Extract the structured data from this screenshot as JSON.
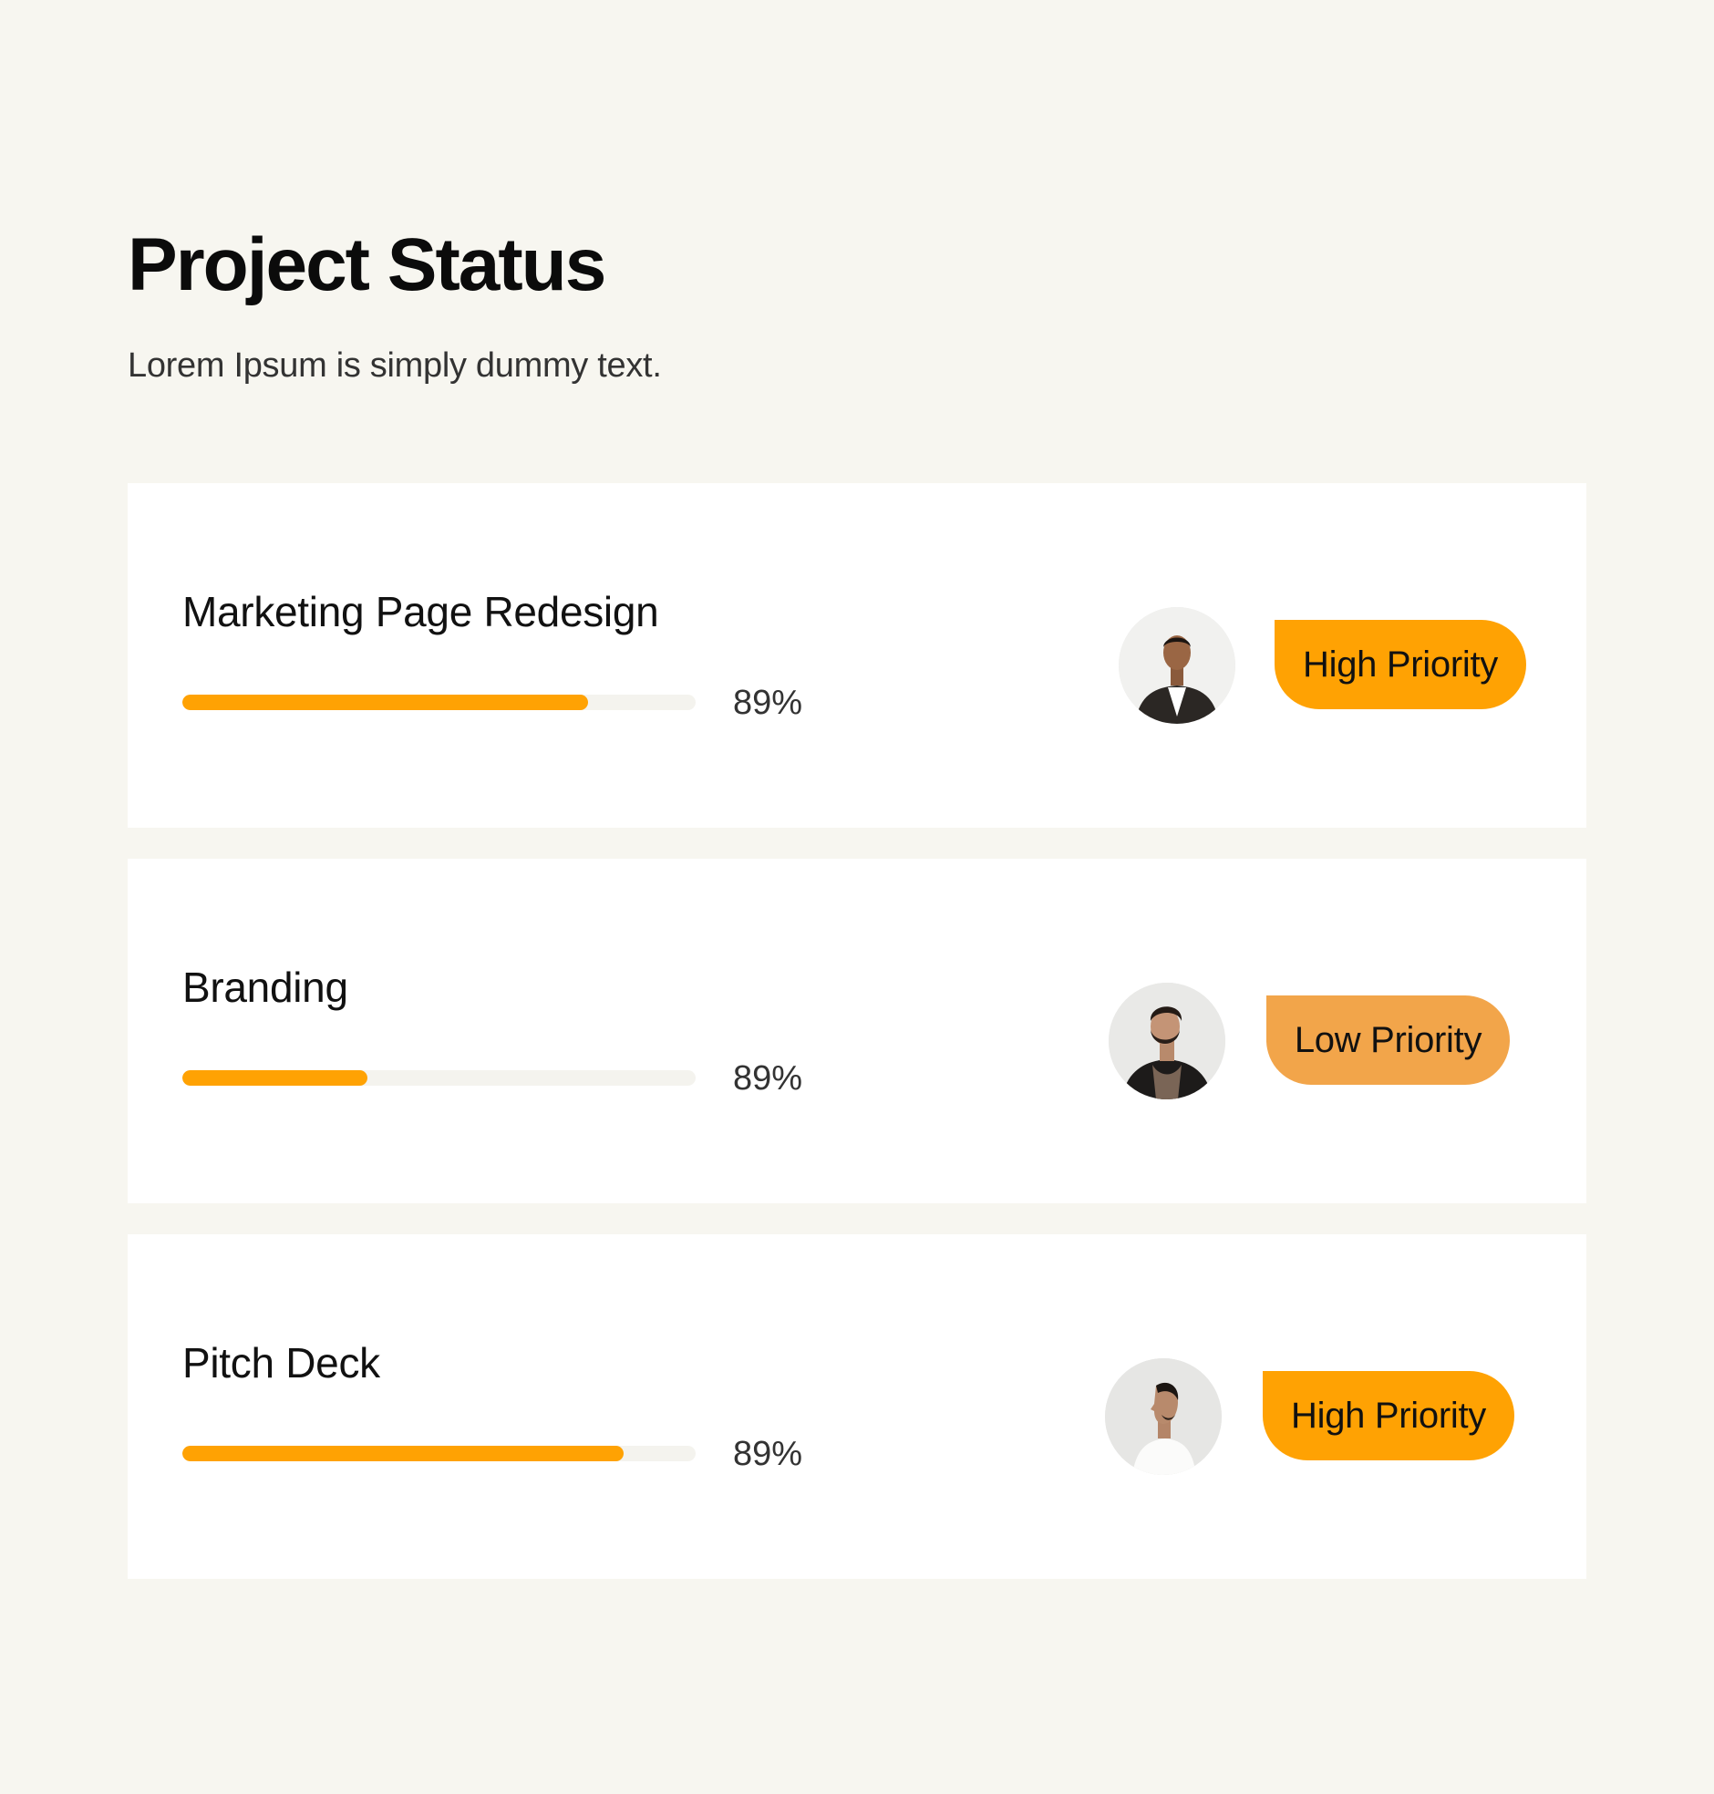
{
  "header": {
    "title": "Project Status",
    "subtitle": "Lorem Ipsum is simply dummy text."
  },
  "projects": [
    {
      "name": "Marketing Page Redesign",
      "progress_fill": 0.79,
      "progress_label": "89%",
      "priority": "High Priority",
      "badge_color": "#ffa203",
      "avatar_icon": "person-in-suit-avatar"
    },
    {
      "name": "Branding",
      "progress_fill": 0.36,
      "progress_label": "89%",
      "priority": "Low Priority",
      "badge_color": "#f2a54a",
      "avatar_icon": "bearded-man-avatar"
    },
    {
      "name": "Pitch Deck",
      "progress_fill": 0.86,
      "progress_label": "89%",
      "priority": "High Priority",
      "badge_color": "#ffa203",
      "avatar_icon": "man-profile-avatar"
    }
  ],
  "colors": {
    "background": "#f7f6f0",
    "card": "#ffffff",
    "progress": "#ffa203",
    "track": "#f4f3ee"
  }
}
